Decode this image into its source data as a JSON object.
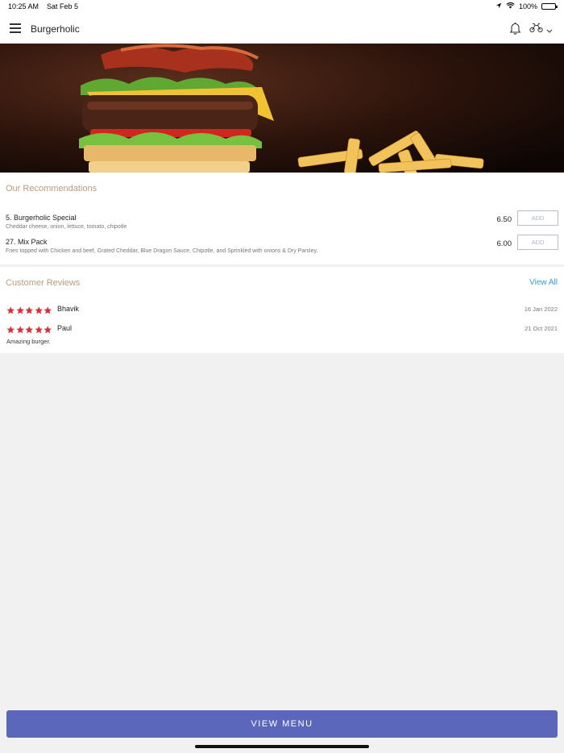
{
  "status": {
    "time": "10:25 AM",
    "date": "Sat Feb 5",
    "battery": "100%",
    "battery_level": 1.0
  },
  "header": {
    "title": "Burgerholic"
  },
  "recommendations": {
    "title": "Our Recommendations",
    "items": [
      {
        "name": "5. Burgerholic Special",
        "desc": "Cheddar cheese, onion, lettuce, tomato, chipotle",
        "price": "6.50",
        "add_label": "ADD"
      },
      {
        "name": "27. Mix Pack",
        "desc": "Fries topped with Chicken and beef, Grated Cheddar, Blue Dragon Sauce, Chipotle, and Sprinkled with onions & Dry Parsley.",
        "price": "6.00",
        "add_label": "ADD"
      }
    ]
  },
  "reviews": {
    "title": "Customer Reviews",
    "view_all": "View All",
    "items": [
      {
        "name": "Bhavik",
        "date": "16 Jan 2022",
        "rating": 5,
        "text": ""
      },
      {
        "name": "Paul",
        "date": "21 Oct 2021",
        "rating": 5,
        "text": "Amazing burger."
      }
    ]
  },
  "footer": {
    "view_menu": "VIEW MENU"
  },
  "colors": {
    "accent": "#5a67bb",
    "section_title": "#b79b7e",
    "link": "#2a9fd8",
    "star": "#d9303a"
  }
}
